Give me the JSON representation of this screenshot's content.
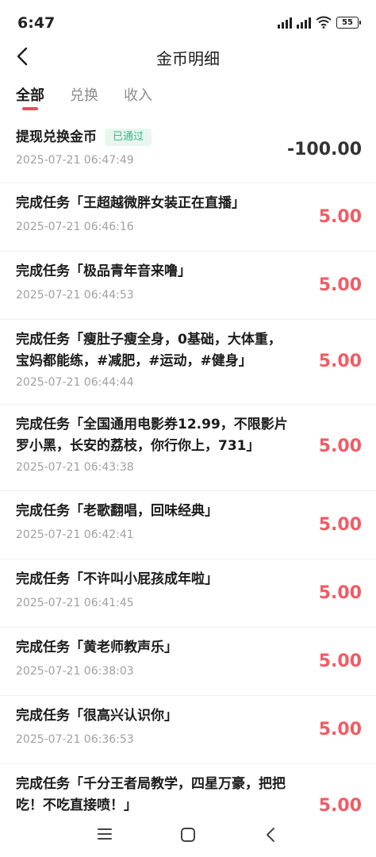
{
  "status": {
    "time": "6:47",
    "battery": "55"
  },
  "nav": {
    "title": "金币明细"
  },
  "tabs": [
    {
      "label": "全部"
    },
    {
      "label": "兑换"
    },
    {
      "label": "收入"
    }
  ],
  "records": [
    {
      "title": "提现兑换金币",
      "badge": "已通过",
      "time": "2025-07-21 06:47:49",
      "amount": "-100.00"
    },
    {
      "title": "完成任务「王超越微胖女装正在直播」",
      "time": "2025-07-21 06:46:16",
      "amount": "5.00"
    },
    {
      "title": "完成任务「极品青年音来噜」",
      "time": "2025-07-21 06:44:53",
      "amount": "5.00"
    },
    {
      "title": "完成任务「瘦肚子瘦全身，0基础，大体重，宝妈都能练，#减肥，#运动，#健身」",
      "time": "2025-07-21 06:44:44",
      "amount": "5.00"
    },
    {
      "title": "完成任务「全国通用电影券12.99，不限影片罗小黑，长安的荔枝，你行你上，731」",
      "time": "2025-07-21 06:43:38",
      "amount": "5.00"
    },
    {
      "title": "完成任务「老歌翻唱，回味经典」",
      "time": "2025-07-21 06:42:41",
      "amount": "5.00"
    },
    {
      "title": "完成任务「不许叫小屁孩成年啦」",
      "time": "2025-07-21 06:41:45",
      "amount": "5.00"
    },
    {
      "title": "完成任务「黄老师教声乐」",
      "time": "2025-07-21 06:38:03",
      "amount": "5.00"
    },
    {
      "title": "完成任务「很高兴认识你」",
      "time": "2025-07-21 06:36:53",
      "amount": "5.00"
    },
    {
      "title": "完成任务「千分王者局教学，四星万豪，把把吃！不吃直接喷！」",
      "amount": "5.00"
    }
  ]
}
